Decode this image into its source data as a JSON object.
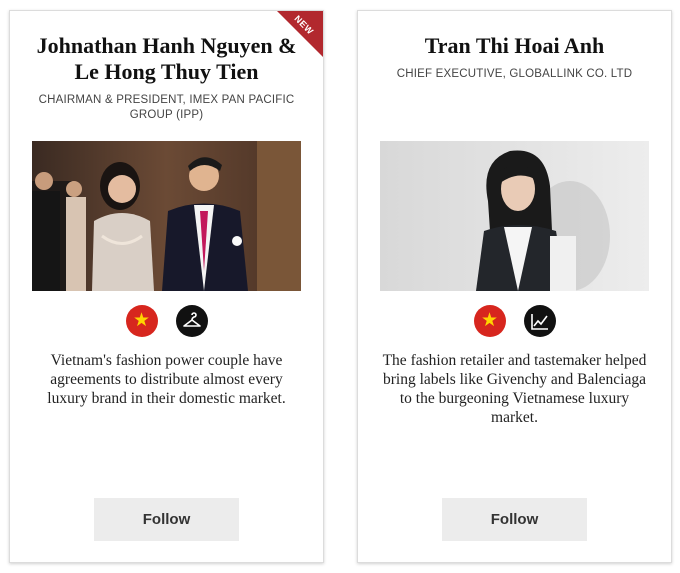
{
  "cards": [
    {
      "badge": "NEW",
      "name": "Johnathan Hanh Nguyen & Le Hong Thuy Tien",
      "title": "Chairman & President, IMEX Pan Pacific Group (IPP)",
      "icons": [
        "vietnam-flag-icon",
        "hanger-icon"
      ],
      "description": "Vietnam's fashion power couple have agreements to distribute almost every luxury brand in their domestic market.",
      "follow_label": "Follow"
    },
    {
      "name": "Tran Thi Hoai Anh",
      "title": "Chief Executive, Globallink Co. Ltd",
      "icons": [
        "vietnam-flag-icon",
        "chart-icon"
      ],
      "description": "The fashion retailer and tastemaker helped bring labels like Givenchy and Balenciaga to the burgeoning Vietnamese luxury market.",
      "follow_label": "Follow"
    }
  ],
  "colors": {
    "badge": "#b2282e",
    "flag_red": "#d7261e",
    "flag_star": "#ffd400",
    "button_bg": "#ececec"
  }
}
